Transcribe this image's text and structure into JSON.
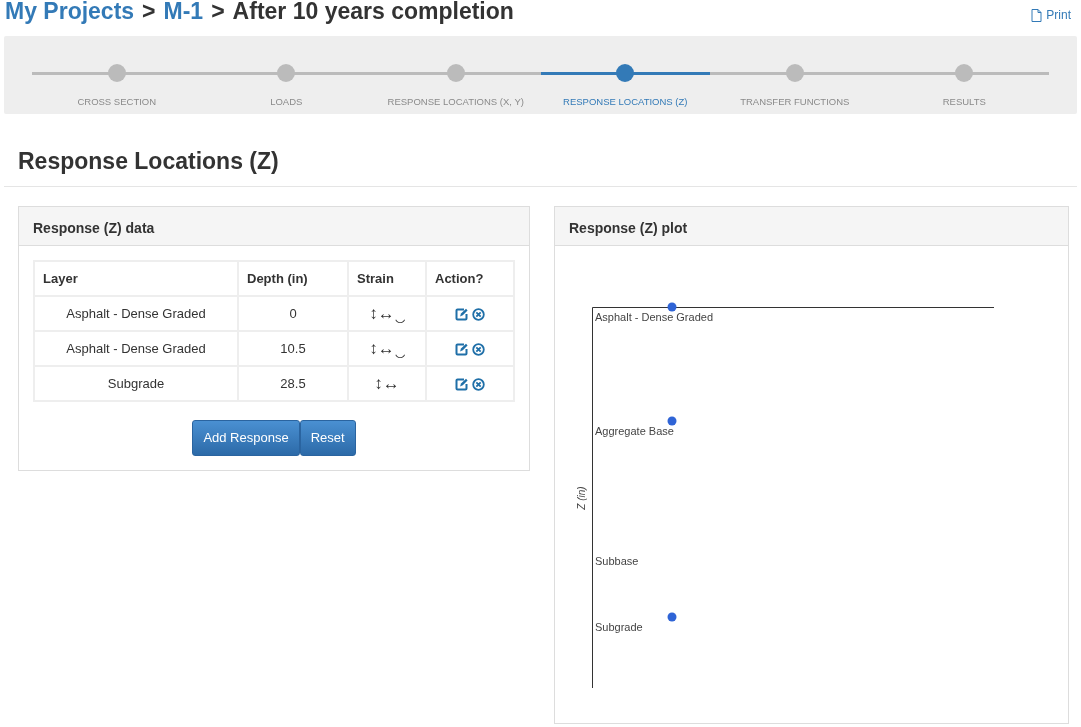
{
  "breadcrumb": [
    {
      "kind": "link",
      "label": "My Projects"
    },
    {
      "kind": "separator",
      "label": ">"
    },
    {
      "kind": "link",
      "label": "M-1"
    },
    {
      "kind": "separator",
      "label": ">"
    },
    {
      "kind": "current",
      "label": "After 10 years completion"
    }
  ],
  "print": {
    "label": "Print"
  },
  "steps": [
    {
      "label": "CROSS SECTION",
      "selected": false
    },
    {
      "label": "LOADS",
      "selected": false
    },
    {
      "label": "RESPONSE LOCATIONS (X, Y)",
      "selected": false
    },
    {
      "label": "RESPONSE LOCATIONS (Z)",
      "selected": true
    },
    {
      "label": "TRANSFER FUNCTIONS",
      "selected": false
    },
    {
      "label": "RESULTS",
      "selected": false
    }
  ],
  "page_title": "Response Locations (Z)",
  "data_panel": {
    "title": "Response (Z) data",
    "table": {
      "columns": [
        "Layer",
        "Depth (in)",
        "Strain",
        "Action?"
      ],
      "rows": [
        {
          "layer": "Asphalt - Dense Graded",
          "depth": "0",
          "strain": "↕↔‿"
        },
        {
          "layer": "Asphalt - Dense Graded",
          "depth": "10.5",
          "strain": "↕↔‿"
        },
        {
          "layer": "Subgrade",
          "depth": "28.5",
          "strain": "↕↔"
        }
      ]
    },
    "buttons": [
      "Add Response",
      "Reset"
    ]
  },
  "plot_panel": {
    "title": "Response (Z) plot",
    "ylabel": "Z (in)",
    "layer_labels": [
      "Asphalt - Dense Graded",
      "Aggregate Base",
      "Subbase",
      "Subgrade"
    ]
  }
}
